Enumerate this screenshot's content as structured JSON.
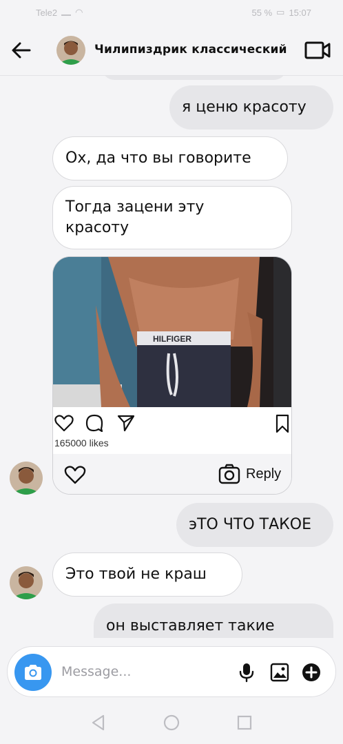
{
  "status_bar": {
    "carrier": "Tele2",
    "battery": "55 %",
    "time": "15:07"
  },
  "header": {
    "back_icon": "arrow-left-icon",
    "contact_name": "Чилипиздрик классический",
    "video_icon": "video-camera-icon"
  },
  "messages": [
    {
      "side": "out",
      "text": "я ценю красоту"
    },
    {
      "side": "in",
      "text": "Ох, да что вы говорите"
    },
    {
      "side": "in",
      "text": "Тогда зацени эту красоту"
    },
    {
      "side": "out",
      "text": "эТО ЧТО ТАКОЕ"
    },
    {
      "side": "in",
      "text": "Это твой не краш"
    },
    {
      "side": "out",
      "text": "он выставляет такие"
    }
  ],
  "shared_post": {
    "photo_caption_text": "HILFIGER",
    "likes": "165000 likes",
    "reply_label": "Reply"
  },
  "composer": {
    "placeholder": "Message..."
  },
  "colors": {
    "accent": "#3897f0",
    "background": "#f4f4f6",
    "incoming_bubble": "#ffffff",
    "outgoing_bubble": "#e6e6e9"
  }
}
